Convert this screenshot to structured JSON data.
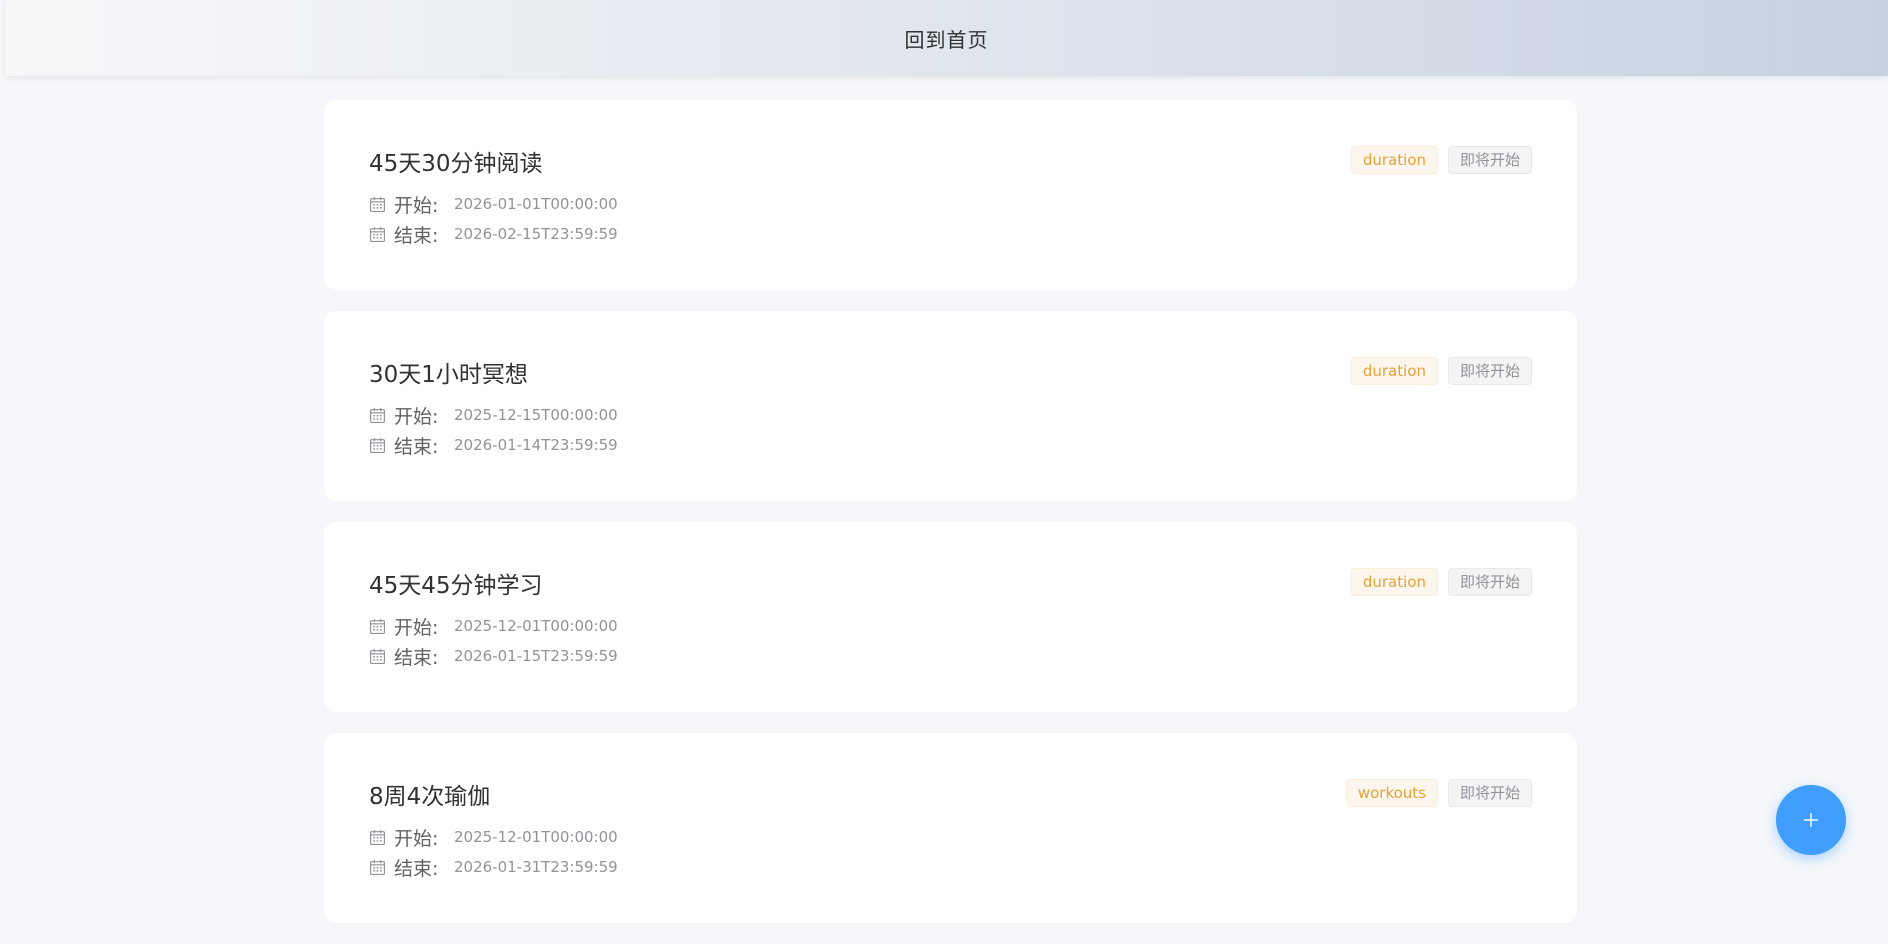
{
  "header": {
    "title": "回到首页"
  },
  "challenges": [
    {
      "title": "45天30分钟阅读",
      "type_tag": "duration",
      "status_tag": "即将开始",
      "start_label": "开始:",
      "start": "2026-01-01T00:00:00",
      "end_label": "结束:",
      "end": "2026-02-15T23:59:59"
    },
    {
      "title": "30天1小时冥想",
      "type_tag": "duration",
      "status_tag": "即将开始",
      "start_label": "开始:",
      "start": "2025-12-15T00:00:00",
      "end_label": "结束:",
      "end": "2026-01-14T23:59:59"
    },
    {
      "title": "45天45分钟学习",
      "type_tag": "duration",
      "status_tag": "即将开始",
      "start_label": "开始:",
      "start": "2025-12-01T00:00:00",
      "end_label": "结束:",
      "end": "2026-01-15T23:59:59"
    },
    {
      "title": "8周4次瑜伽",
      "type_tag": "workouts",
      "status_tag": "即将开始",
      "start_label": "开始:",
      "start": "2025-12-01T00:00:00",
      "end_label": "结束:",
      "end": "2026-01-31T23:59:59"
    }
  ],
  "fab": {
    "icon": "plus-icon"
  },
  "colors": {
    "accent": "#409eff",
    "warning": "#e6a23c",
    "info": "#909399"
  }
}
